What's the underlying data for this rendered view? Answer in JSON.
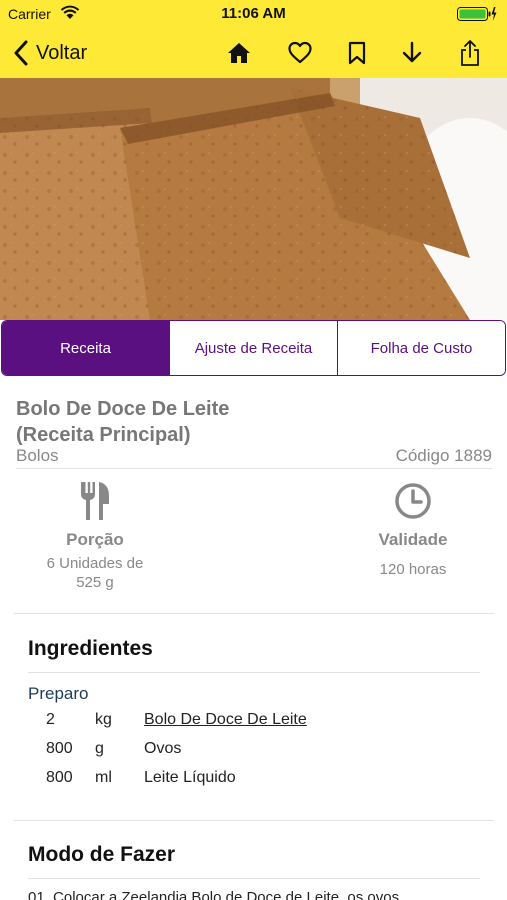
{
  "status_bar": {
    "carrier": "Carrier",
    "time": "11:06 AM",
    "icons": [
      "wifi-icon",
      "battery-icon",
      "charging-bolt-icon"
    ]
  },
  "nav": {
    "back_label": "Voltar",
    "icons": [
      "home-icon",
      "heart-icon",
      "bookmark-icon",
      "download-arrow-icon",
      "share-icon"
    ]
  },
  "colors": {
    "bar_yellow": "#fde936",
    "accent_purple": "#5a1080",
    "muted_text": "#888888"
  },
  "tabs": [
    {
      "label": "Receita",
      "active": true
    },
    {
      "label": "Ajuste de Receita",
      "active": false
    },
    {
      "label": "Folha de Custo",
      "active": false
    }
  ],
  "recipe": {
    "title_line1": "Bolo De Doce De Leite",
    "title_line2": "(Receita Principal)",
    "category": "Bolos",
    "code": "Código 1889"
  },
  "portion": {
    "icon": "fork-knife-icon",
    "label": "Porção",
    "value_line1": "6 Unidades de",
    "value_line2": "525 g"
  },
  "validity": {
    "icon": "clock-icon",
    "label": "Validade",
    "value": "120 horas"
  },
  "ingredients": {
    "title": "Ingredientes",
    "group": "Preparo",
    "items": [
      {
        "qty": "2",
        "unit": "kg",
        "name": "Bolo De Doce De Leite",
        "link": true
      },
      {
        "qty": "800",
        "unit": "g",
        "name": "Ovos",
        "link": false
      },
      {
        "qty": "800",
        "unit": "ml",
        "name": "Leite Líquido",
        "link": false
      }
    ]
  },
  "method": {
    "title": "Modo de Fazer",
    "first_line": "01. Colocar a Zeelandia Bolo de Doce de Leite, os ovos"
  }
}
